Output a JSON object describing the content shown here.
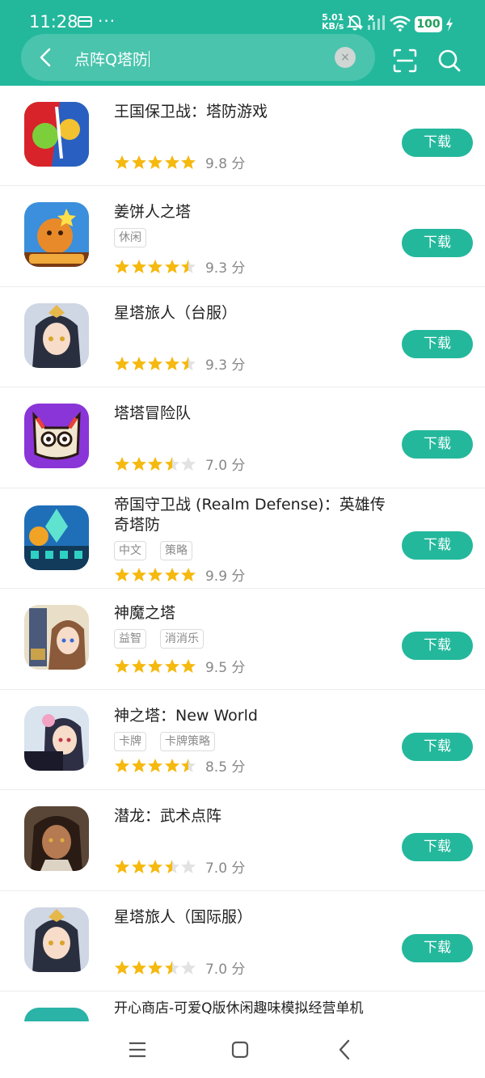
{
  "status_bar": {
    "time": "11:28",
    "net_speed_value": "5.01",
    "net_speed_unit": "KB/s",
    "battery": "100",
    "icons": [
      "card-icon",
      "more-dots-icon",
      "bell-muted-icon",
      "signal-icon",
      "wifi-icon",
      "battery-icon",
      "charging-icon"
    ]
  },
  "search": {
    "query": "点阵Q塔防",
    "clear_symbol": "×",
    "icons": [
      "back-arrow-icon",
      "clear-icon",
      "scan-icon",
      "search-icon"
    ]
  },
  "colors": {
    "accent": "#23b89c",
    "star": "#f5b90f",
    "star_empty": "#e2e2e2"
  },
  "download_label": "下载",
  "apps": [
    {
      "name": "王国保卫战：塔防游戏",
      "tags": [],
      "rating": 5.0,
      "score_text": "9.8 分"
    },
    {
      "name": "姜饼人之塔",
      "tags": [
        "休闲"
      ],
      "rating": 4.5,
      "score_text": "9.3 分"
    },
    {
      "name": "星塔旅人（台服）",
      "tags": [],
      "rating": 4.5,
      "score_text": "9.3 分"
    },
    {
      "name": "塔塔冒险队",
      "tags": [],
      "rating": 3.5,
      "score_text": "7.0 分"
    },
    {
      "name": "帝国守卫战 (Realm Defense)：英雄传奇塔防",
      "tags": [
        "中文",
        "策略"
      ],
      "rating": 5.0,
      "score_text": "9.9 分"
    },
    {
      "name": "神魔之塔",
      "tags": [
        "益智",
        "消消乐"
      ],
      "rating": 5.0,
      "score_text": "9.5 分"
    },
    {
      "name": "神之塔：New World",
      "tags": [
        "卡牌",
        "卡牌策略"
      ],
      "rating": 4.5,
      "score_text": "8.5 分"
    },
    {
      "name": "潜龙：武术点阵",
      "tags": [],
      "rating": 3.5,
      "score_text": "7.0 分"
    },
    {
      "name": "星塔旅人（国际服）",
      "tags": [],
      "rating": 3.5,
      "score_text": "7.0 分"
    },
    {
      "name": "开心商店-可爱Q版休闲趣味模拟经营单机",
      "tags": [],
      "rating": null,
      "score_text": ""
    }
  ],
  "nav_bar": {
    "icons": [
      "menu-icon",
      "home-icon",
      "back-icon"
    ]
  }
}
